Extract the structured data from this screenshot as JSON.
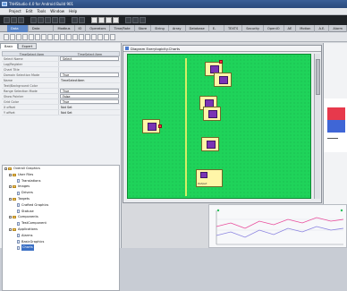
{
  "window": {
    "title": "ThHStudio 4.0 for Android Build 901"
  },
  "menu": [
    "Project",
    "Edit",
    "Tools",
    "Window",
    "Help"
  ],
  "tabs": [
    "Data Sources",
    "Data Formatting",
    "Modbus",
    "IO",
    "Operators",
    "Time/Rate",
    "Store",
    "String",
    "Array",
    "Database",
    "E-Diag",
    "TEXTS",
    "Security",
    "OpenIO",
    "AE",
    "Motion",
    "A.E.",
    "Alarm"
  ],
  "active_tab_index": 0,
  "left_tabs": [
    "Basic",
    "Expert"
  ],
  "property_table": {
    "headers": [
      "TimeSelect.Item",
      "TimeSelect.Item"
    ],
    "rows": [
      {
        "name": "Select Name",
        "value": "Select"
      },
      {
        "name": "Log/Register",
        "value": ""
      },
      {
        "name": "Chart Title",
        "value": ""
      },
      {
        "name": "Domain Selection Mode",
        "value": "True"
      },
      {
        "name": "Name",
        "value": "TimeSelectItem"
      },
      {
        "name": "Text/Background Color",
        "value": ""
      },
      {
        "name": "Range Selection Mode",
        "value": "True"
      },
      {
        "name": "Show Pointer",
        "value": "False"
      },
      {
        "name": "Grid Color",
        "value": "True"
      },
      {
        "name": "X offset",
        "value": "Not Set"
      },
      {
        "name": "Y offset",
        "value": "Not Set"
      }
    ]
  },
  "tree": [
    {
      "label": "Overall Graphics",
      "level": 0,
      "type": "folder"
    },
    {
      "label": "User Files",
      "level": 1,
      "type": "folder"
    },
    {
      "label": "Translations",
      "level": 2,
      "type": "doc"
    },
    {
      "label": "Images",
      "level": 1,
      "type": "folder"
    },
    {
      "label": "Drivers",
      "level": 2,
      "type": "doc"
    },
    {
      "label": "Targets",
      "level": 1,
      "type": "folder"
    },
    {
      "label": "Crafted Graphics",
      "level": 2,
      "type": "doc"
    },
    {
      "label": "Statuse",
      "level": 2,
      "type": "doc"
    },
    {
      "label": "Components",
      "level": 1,
      "type": "folder"
    },
    {
      "label": "TestComponent",
      "level": 2,
      "type": "doc"
    },
    {
      "label": "Applications",
      "level": 1,
      "type": "folder"
    },
    {
      "label": "Alarms",
      "level": 2,
      "type": "doc"
    },
    {
      "label": "BasicGraphics",
      "level": 2,
      "type": "doc"
    },
    {
      "label": "Charts",
      "level": 2,
      "type": "doc",
      "selected": true
    }
  ],
  "diagram": {
    "title": "Diagram Everylogicity.Charts",
    "nodes": [
      {
        "id": "n1",
        "label": "",
        "kind": "normal"
      },
      {
        "id": "n2",
        "label": "",
        "kind": "normal"
      },
      {
        "id": "n3",
        "label": "",
        "kind": "normal"
      },
      {
        "id": "n4",
        "label": "",
        "kind": "normal"
      },
      {
        "id": "n5",
        "label": "",
        "kind": "normal"
      },
      {
        "id": "n6",
        "label": "",
        "kind": "normal"
      },
      {
        "id": "n7",
        "label": "Output",
        "kind": "big"
      }
    ]
  },
  "colors": {
    "canvas": "#1fd35a",
    "selection": "#3a6fc4",
    "node_fill": "#fff6a8",
    "node_icon": "#7a34b5",
    "pin": "#ff3344"
  }
}
